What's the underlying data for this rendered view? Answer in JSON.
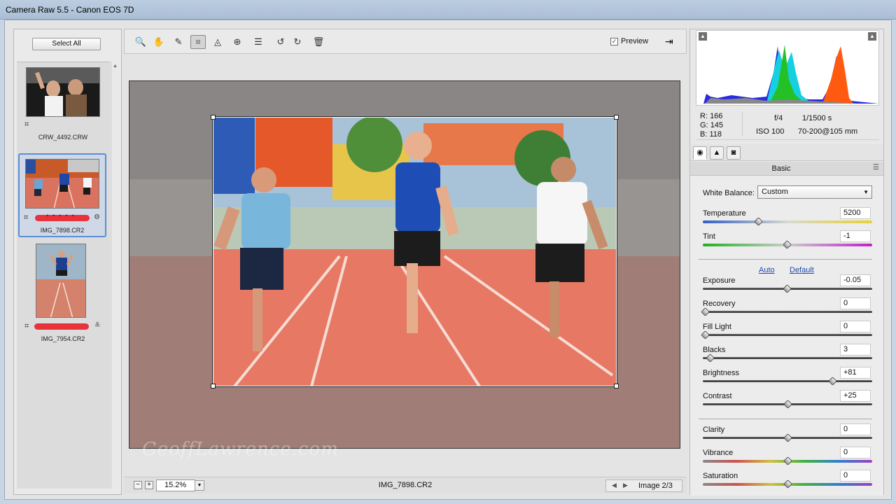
{
  "window": {
    "title": "Camera Raw 5.5  -  Canon EOS 7D"
  },
  "filmstrip": {
    "select_all_label": "Select All",
    "items": [
      {
        "filename": "CRW_4492.CRW",
        "rating": 0,
        "selected": false
      },
      {
        "filename": "IMG_7898.CR2",
        "rating": 5,
        "selected": true
      },
      {
        "filename": "IMG_7954.CR2",
        "rating": 5,
        "selected": false
      }
    ]
  },
  "toolbar": {
    "tools": [
      {
        "name": "zoom-tool-icon",
        "glyph": "🔍"
      },
      {
        "name": "hand-tool-icon",
        "glyph": "✋"
      },
      {
        "name": "white-balance-tool-icon",
        "glyph": "✎"
      },
      {
        "name": "crop-tool-icon",
        "glyph": "⌗"
      },
      {
        "name": "straighten-tool-icon",
        "glyph": "◬"
      },
      {
        "name": "spot-removal-tool-icon",
        "glyph": "⊕"
      },
      {
        "name": "preferences-icon",
        "glyph": "☰"
      },
      {
        "name": "rotate-left-icon",
        "glyph": "↺"
      },
      {
        "name": "rotate-right-icon",
        "glyph": "↻"
      },
      {
        "name": "delete-icon",
        "glyph": "🗑"
      }
    ],
    "active_tool": "crop-tool-icon",
    "preview_label": "Preview",
    "preview_checked": true
  },
  "canvas": {
    "watermark": "GeoffLawrence.com"
  },
  "statusbar": {
    "zoom_value": "15.2%",
    "filename": "IMG_7898.CR2",
    "image_counter": "Image 2/3"
  },
  "histogram": {
    "r_label": "R:",
    "g_label": "G:",
    "b_label": "B:",
    "r": "166",
    "g": "145",
    "b": "118",
    "aperture": "f/4",
    "shutter": "1/1500 s",
    "iso": "ISO 100",
    "lens": "70-200@105 mm"
  },
  "panel": {
    "section_title": "Basic",
    "white_balance_label": "White Balance:",
    "white_balance_value": "Custom",
    "auto_label": "Auto",
    "default_label": "Default",
    "sliders": [
      {
        "key": "temperature",
        "label": "Temperature",
        "value": "5200",
        "fraction": 0.32
      },
      {
        "key": "tint",
        "label": "Tint",
        "value": "-1",
        "fraction": 0.497
      },
      {
        "key": "exposure",
        "label": "Exposure",
        "value": "-0.05",
        "fraction": 0.497
      },
      {
        "key": "recovery",
        "label": "Recovery",
        "value": "0",
        "fraction": 0.0
      },
      {
        "key": "fill_light",
        "label": "Fill Light",
        "value": "0",
        "fraction": 0.0
      },
      {
        "key": "blacks",
        "label": "Blacks",
        "value": "3",
        "fraction": 0.03
      },
      {
        "key": "brightness",
        "label": "Brightness",
        "value": "+81",
        "fraction": 0.77
      },
      {
        "key": "contrast",
        "label": "Contrast",
        "value": "+25",
        "fraction": 0.5
      },
      {
        "key": "clarity",
        "label": "Clarity",
        "value": "0",
        "fraction": 0.5
      },
      {
        "key": "vibrance",
        "label": "Vibrance",
        "value": "0",
        "fraction": 0.5
      },
      {
        "key": "saturation",
        "label": "Saturation",
        "value": "0",
        "fraction": 0.5
      }
    ]
  }
}
